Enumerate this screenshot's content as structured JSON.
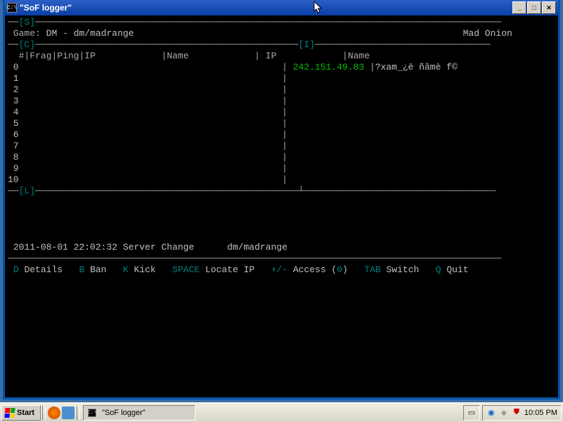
{
  "window": {
    "icon_text": "C:\\",
    "title": "\"SoF logger\""
  },
  "status": {
    "game_label": "Game:",
    "game_mode": "DM",
    "game_map": "dm/madrange",
    "server_name": "Mad Onion"
  },
  "box_labels": {
    "status": "S",
    "clients": "C",
    "info": "I",
    "log": "L"
  },
  "clients": {
    "headers": {
      "num": "#",
      "frag": "Frag",
      "ping": "Ping",
      "ip": "IP",
      "name": "Name"
    },
    "rows": [
      " 0",
      " 1",
      " 2",
      " 3",
      " 4",
      " 5",
      " 6",
      " 7",
      " 8",
      " 9",
      "10"
    ]
  },
  "info": {
    "headers": {
      "ip": "IP",
      "name": "Name"
    },
    "entry": {
      "ip": "242.151.49.83",
      "name": "?xam_¿ë ñâmè f©"
    }
  },
  "log": {
    "timestamp": "2011-08-01 22:02:32",
    "event": "Server Change",
    "detail": "dm/madrange"
  },
  "footer": {
    "d_key": "D",
    "d_label": "Details",
    "b_key": "B",
    "b_label": "Ban",
    "k_key": "K",
    "k_label": "Kick",
    "space_key": "SPACE",
    "space_label": "Locate IP",
    "pm_key": "+/-",
    "pm_label": "Access (",
    "pm_count": "0",
    "pm_close": ")",
    "tab_key": "TAB",
    "tab_label": "Switch",
    "q_key": "Q",
    "q_label": "Quit"
  },
  "taskbar": {
    "start": "Start",
    "task_title": "\"SoF logger\"",
    "clock": "10:05 PM"
  }
}
